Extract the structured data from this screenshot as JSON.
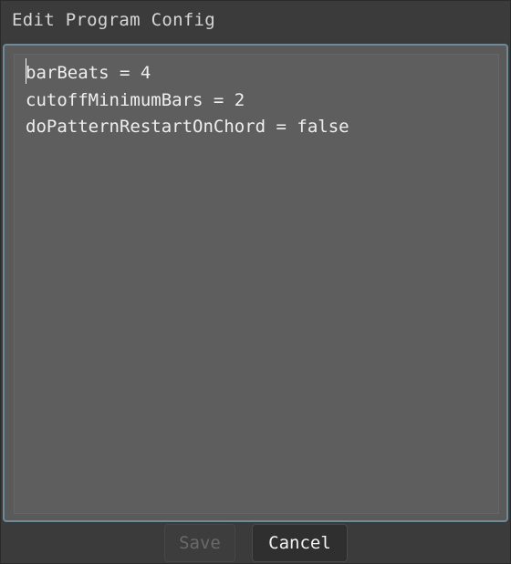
{
  "dialog": {
    "title": "Edit Program Config"
  },
  "editor": {
    "content": "barBeats = 4\ncutoffMinimumBars = 2\ndoPatternRestartOnChord = false"
  },
  "footer": {
    "save_label": "Save",
    "cancel_label": "Cancel",
    "save_enabled": false
  },
  "colors": {
    "background": "#3b3b3b",
    "editor_background": "#5e5e5e",
    "focus_border": "#6d8a98",
    "text": "#efefef",
    "disabled_text": "#6a6a6a"
  }
}
